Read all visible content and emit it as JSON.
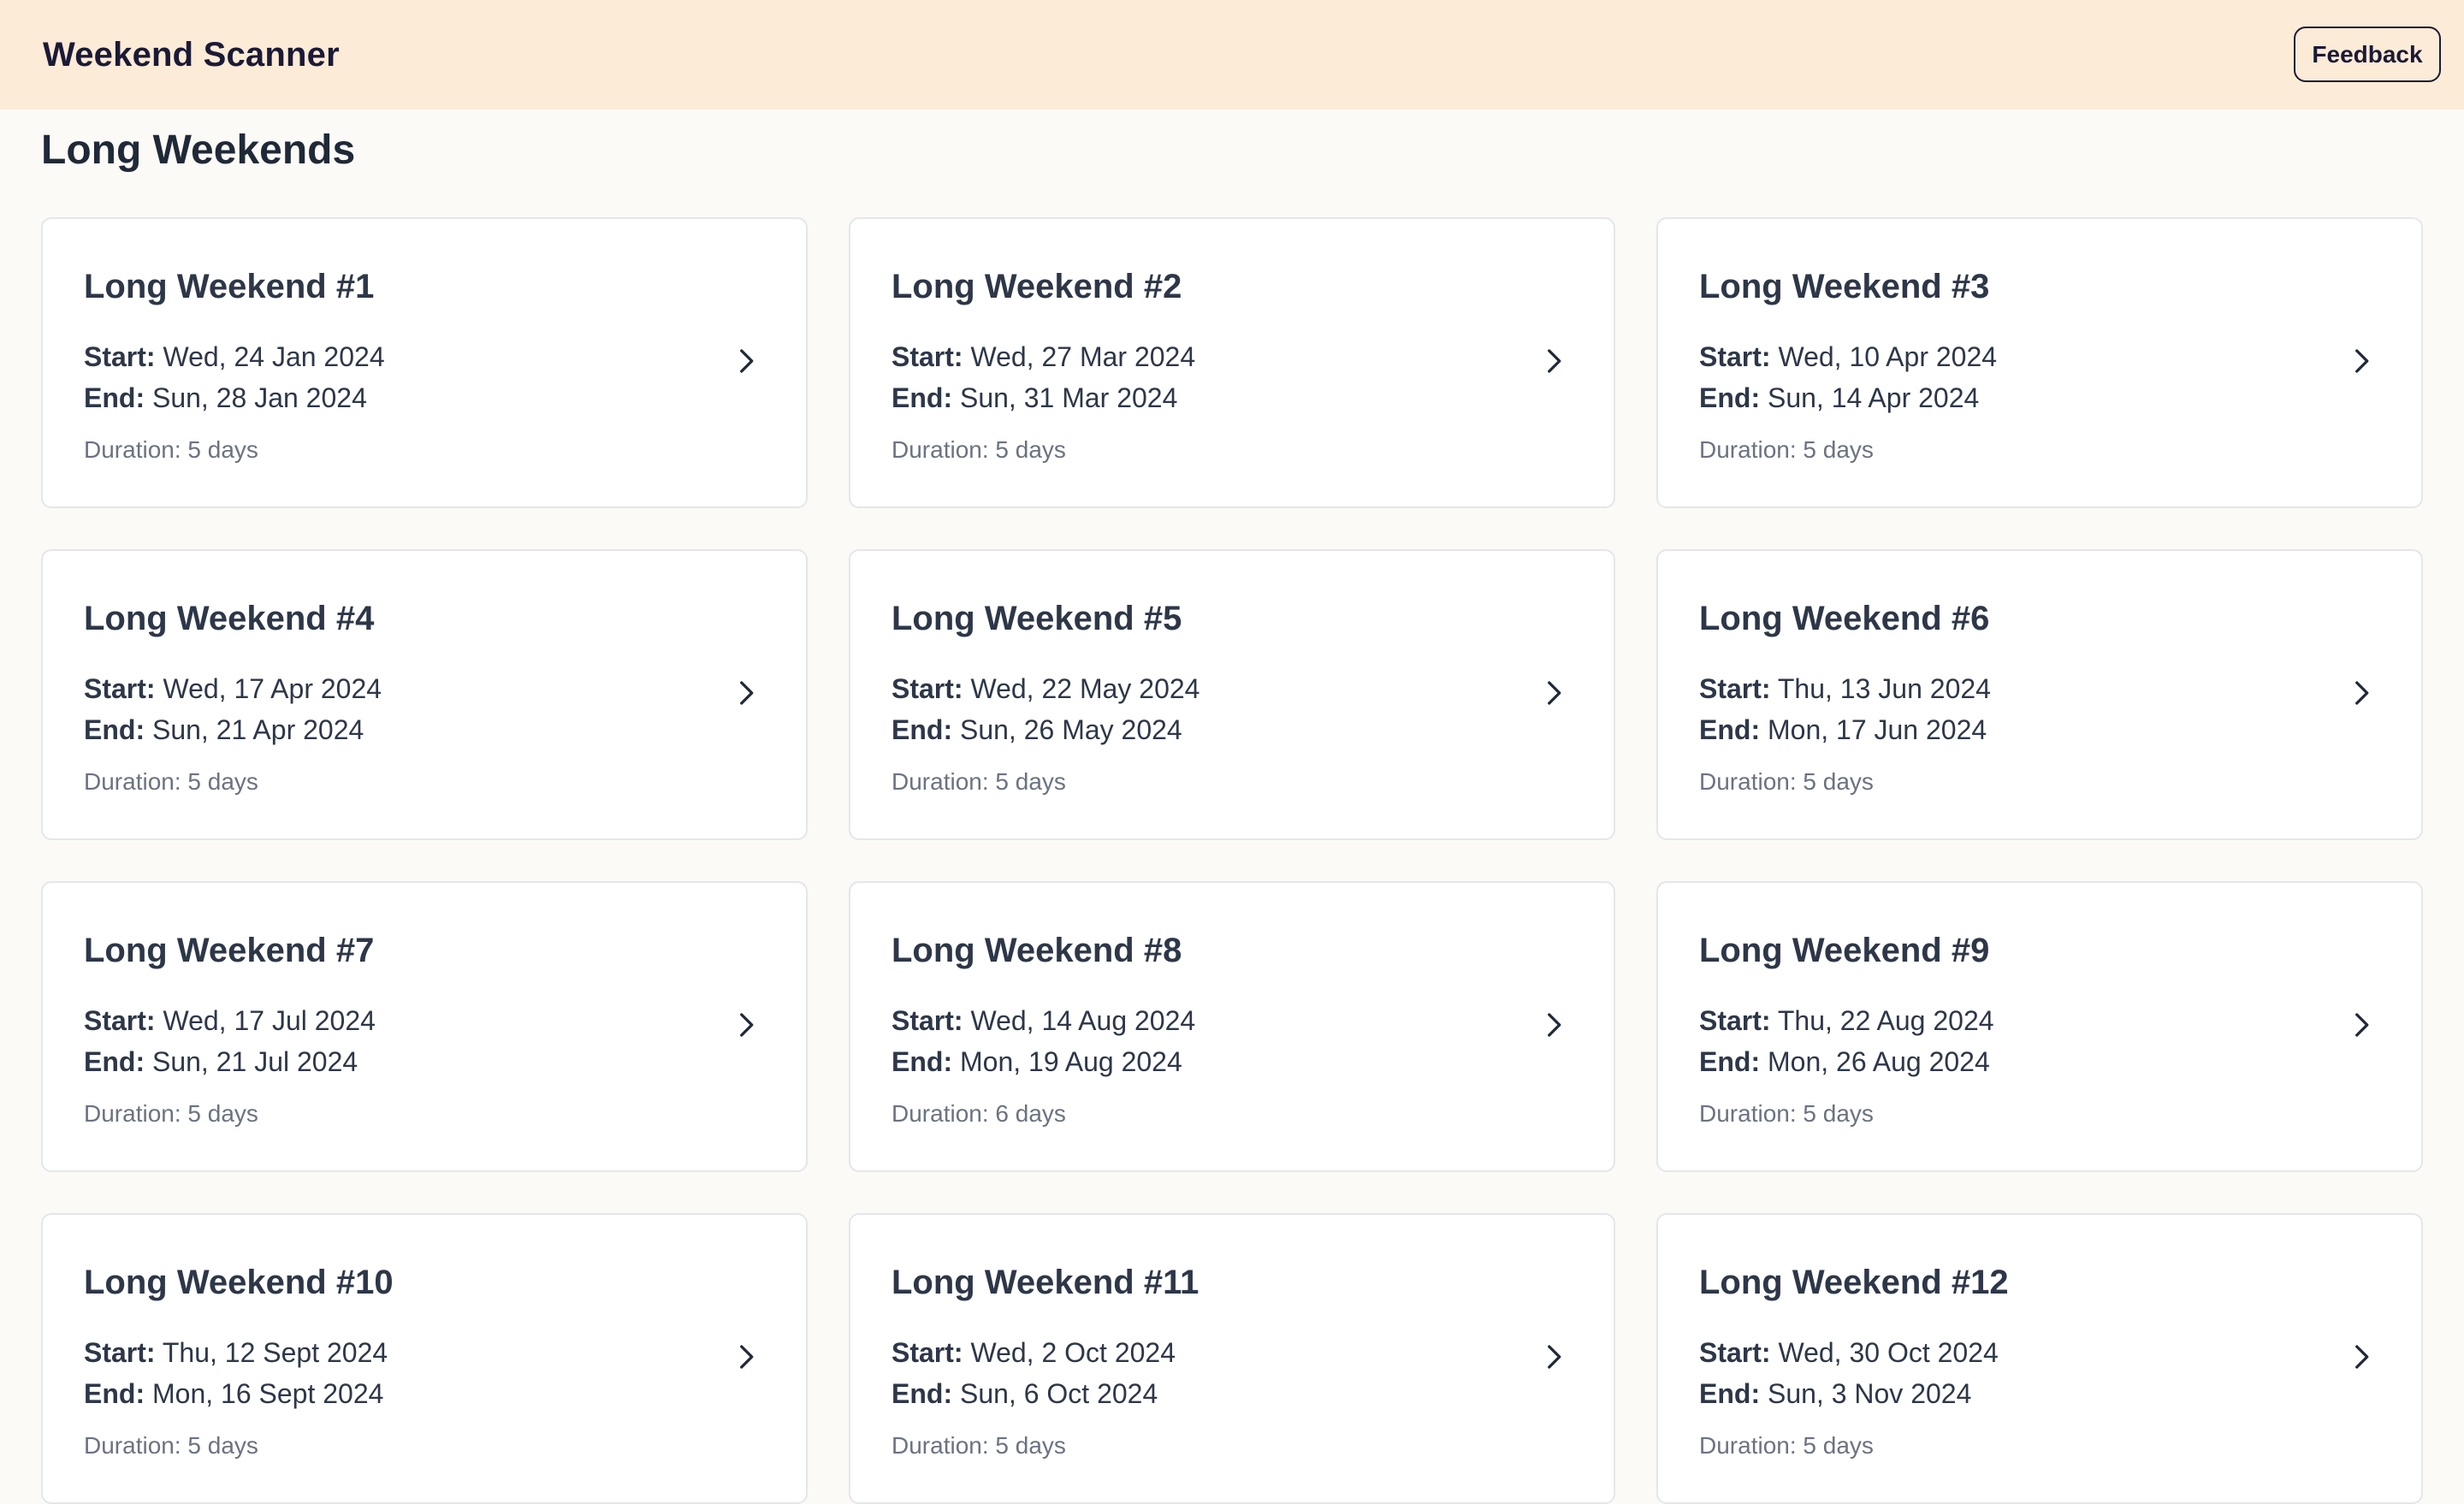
{
  "header": {
    "brand": "Weekend Scanner",
    "feedback_label": "Feedback"
  },
  "main": {
    "title": "Long Weekends",
    "start_label": "Start:",
    "end_label": "End:",
    "duration_prefix": "Duration:",
    "cards": [
      {
        "title": "Long Weekend #1",
        "start": "Wed, 24 Jan 2024",
        "end": "Sun, 28 Jan 2024",
        "duration": "5 days"
      },
      {
        "title": "Long Weekend #2",
        "start": "Wed, 27 Mar 2024",
        "end": "Sun, 31 Mar 2024",
        "duration": "5 days"
      },
      {
        "title": "Long Weekend #3",
        "start": "Wed, 10 Apr 2024",
        "end": "Sun, 14 Apr 2024",
        "duration": "5 days"
      },
      {
        "title": "Long Weekend #4",
        "start": "Wed, 17 Apr 2024",
        "end": "Sun, 21 Apr 2024",
        "duration": "5 days"
      },
      {
        "title": "Long Weekend #5",
        "start": "Wed, 22 May 2024",
        "end": "Sun, 26 May 2024",
        "duration": "5 days"
      },
      {
        "title": "Long Weekend #6",
        "start": "Thu, 13 Jun 2024",
        "end": "Mon, 17 Jun 2024",
        "duration": "5 days"
      },
      {
        "title": "Long Weekend #7",
        "start": "Wed, 17 Jul 2024",
        "end": "Sun, 21 Jul 2024",
        "duration": "5 days"
      },
      {
        "title": "Long Weekend #8",
        "start": "Wed, 14 Aug 2024",
        "end": "Mon, 19 Aug 2024",
        "duration": "6 days"
      },
      {
        "title": "Long Weekend #9",
        "start": "Thu, 22 Aug 2024",
        "end": "Mon, 26 Aug 2024",
        "duration": "5 days"
      },
      {
        "title": "Long Weekend #10",
        "start": "Thu, 12 Sept 2024",
        "end": "Mon, 16 Sept 2024",
        "duration": "5 days"
      },
      {
        "title": "Long Weekend #11",
        "start": "Wed, 2 Oct 2024",
        "end": "Sun, 6 Oct 2024",
        "duration": "5 days"
      },
      {
        "title": "Long Weekend #12",
        "start": "Wed, 30 Oct 2024",
        "end": "Sun, 3 Nov 2024",
        "duration": "5 days"
      }
    ]
  },
  "icons": {
    "card_arrow": "chevron-right-icon"
  },
  "colors": {
    "header_bg": "#fcebd7",
    "page_bg": "#fbfaf7",
    "text": "#2d3748",
    "muted": "#6b7280",
    "brand": "#1b1a36"
  }
}
